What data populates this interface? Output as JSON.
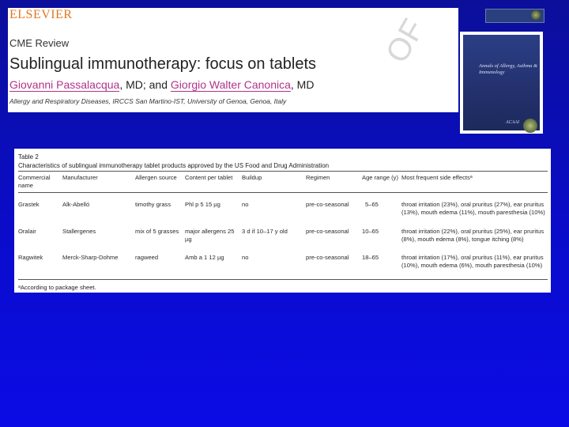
{
  "article": {
    "publisher": "ELSEVIER",
    "section": "CME Review",
    "title": "Sublingual immunotherapy: focus on tablets",
    "author1": "Giovanni Passalacqua",
    "author_sep1": ", MD; and ",
    "author2": "Giorgio Walter Canonica",
    "author_sep2": ", MD",
    "affiliation": "Allergy and Respiratory Diseases, IRCCS San Martino-IST, University of Genoa, Genoa, Italy",
    "watermark": "OF"
  },
  "journal": {
    "cover_title": "Annals of Allergy, Asthma & Immunology",
    "cover_logo": "ACAAI"
  },
  "table": {
    "label": "Table 2",
    "caption": "Characteristics of sublingual immunotherapy tablet products approved by the US Food and Drug Administration",
    "headers": [
      "Commercial name",
      "Manufacturer",
      "Allergen source",
      "Content per tablet",
      "Buildup",
      "Regimen",
      "Age range (y)",
      "Most frequent side effectsᵃ"
    ],
    "rows": [
      [
        "Grastek",
        "Alk-Abelló",
        "timothy grass",
        "Phl p 5 15 µg",
        "no",
        "pre-co-seasonal",
        "5–65",
        "throat irritation (23%), oral pruritus (27%), ear pruritus (13%), mouth edema (11%), mouth paresthesia (10%)"
      ],
      [
        "Oralair",
        "Stallergenes",
        "mix of 5 grasses",
        "major allergens 25 µg",
        "3 d if 10–17 y old",
        "pre-co-seasonal",
        "10–65",
        "throat irritation (22%), oral pruritus (25%), ear pruritus (8%), mouth edema (8%), tongue itching (8%)"
      ],
      [
        "Ragwitek",
        "Merck-Sharp-Dohme",
        "ragweed",
        "Amb a 1 12 µg",
        "no",
        "pre-co-seasonal",
        "18–65",
        "throat irritation (17%), oral pruritus (11%), ear pruritus (10%), mouth edema (6%), mouth paresthesia (10%)"
      ]
    ],
    "footnote": "ᵃAccording to package sheet."
  }
}
